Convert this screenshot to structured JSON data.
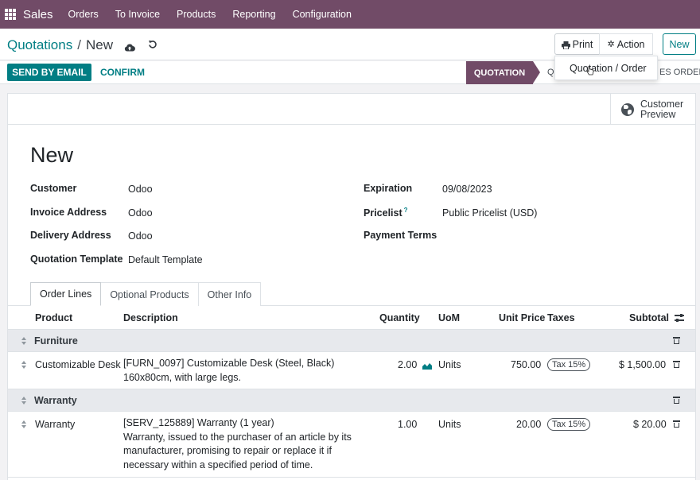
{
  "navbar": {
    "app_name": "Sales",
    "menu": [
      "Orders",
      "To Invoice",
      "Products",
      "Reporting",
      "Configuration"
    ]
  },
  "control": {
    "breadcrumb_parent": "Quotations",
    "breadcrumb_separator": "/",
    "breadcrumb_current": "New",
    "print_label": "Print",
    "action_label": "Action",
    "new_label": "New"
  },
  "dropdown": {
    "item": "Quotation / Order"
  },
  "statusbar": {
    "send_label": "SEND BY EMAIL",
    "confirm_label": "CONFIRM",
    "stage_active": "QUOTATION",
    "stage_partial_left": "Q",
    "stage_partial_right": "ES ORDER"
  },
  "sheet": {
    "preview_label_1": "Customer",
    "preview_label_2": "Preview",
    "title": "New",
    "fields_left": [
      {
        "label": "Customer",
        "value": "Odoo"
      },
      {
        "label": "Invoice Address",
        "value": "Odoo"
      },
      {
        "label": "Delivery Address",
        "value": "Odoo"
      },
      {
        "label": "Quotation Template",
        "value": "Default Template"
      }
    ],
    "fields_right": [
      {
        "label": "Expiration",
        "value": "09/08/2023"
      },
      {
        "label": "Pricelist",
        "help": "?",
        "value": "Public Pricelist (USD)"
      },
      {
        "label": "Payment Terms",
        "value": ""
      }
    ],
    "tabs": [
      "Order Lines",
      "Optional Products",
      "Other Info"
    ]
  },
  "table": {
    "headers": {
      "product": "Product",
      "description": "Description",
      "quantity": "Quantity",
      "uom": "UoM",
      "unit_price": "Unit Price",
      "taxes": "Taxes",
      "subtotal": "Subtotal"
    },
    "sections": [
      "Furniture",
      "Warranty"
    ],
    "lines": [
      {
        "product": "Customizable Desk",
        "description": [
          "[FURN_0097] Customizable Desk (Steel, Black)",
          "160x80cm, with large legs."
        ],
        "quantity": "2.00",
        "uom": "Units",
        "unit_price": "750.00",
        "tax": "Tax 15%",
        "subtotal": "$ 1,500.00"
      },
      {
        "product": "Warranty",
        "description": [
          "[SERV_125889] Warranty (1 year)",
          "Warranty, issued to the purchaser of an article by its",
          "manufacturer, promising to repair or replace it if",
          "necessary within a specified period of time."
        ],
        "quantity": "1.00",
        "uom": "Units",
        "unit_price": "20.00",
        "tax": "Tax 15%",
        "subtotal": "$ 20.00"
      }
    ]
  }
}
